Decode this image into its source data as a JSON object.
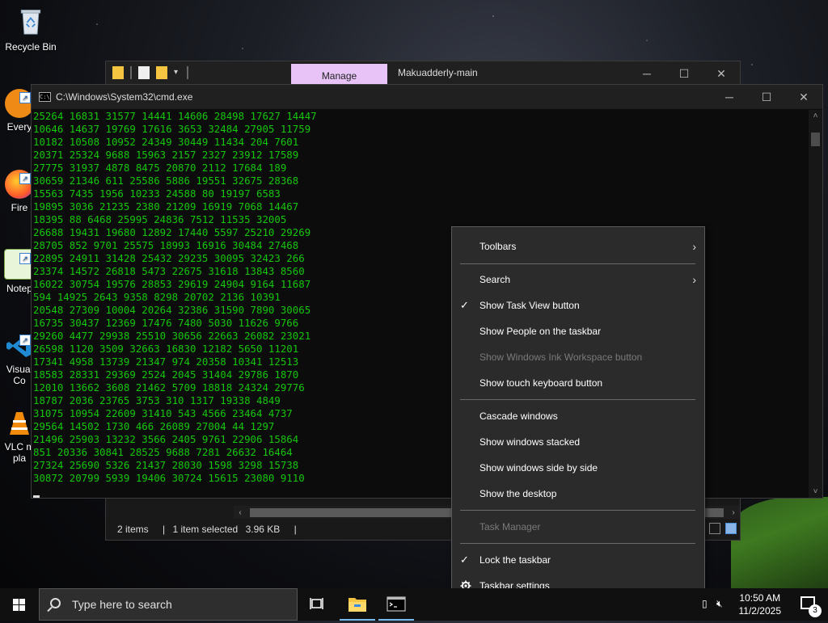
{
  "desktop": {
    "icons": [
      {
        "label": "Recycle Bin"
      },
      {
        "label": "Every"
      },
      {
        "label": "Fire"
      },
      {
        "label": "Notep"
      },
      {
        "label": "Visual"
      },
      {
        "label": "Co"
      },
      {
        "label": "VLC m"
      },
      {
        "label": "pla"
      }
    ]
  },
  "explorer": {
    "manage_tab": "Manage",
    "title": "Makuadderly-main",
    "status": {
      "items": "2 items",
      "selected": "1 item selected",
      "size": "3.96 KB"
    }
  },
  "cmd": {
    "title": "C:\\Windows\\System32\\cmd.exe",
    "lines": [
      "25264 16831 31577 14441 14606 28498 17627 14447",
      "10646 14637 19769 17616 3653 32484 27905 11759",
      "10182 10508 10952 24349 30449 11434 204 7601",
      "20371 25324 9688 15963 2157 2327 23912 17589",
      "27775 31937 4878 8475 20870 2112 17684 189",
      "30659 21346 611 25586 5886 19551 32675 28368",
      "15563 7435 1956 10233 24588 80 19197 6583",
      "19895 3036 21235 2380 21209 16919 7068 14467",
      "18395 88 6468 25995 24836 7512 11535 32005",
      "26688 19431 19680 12892 17440 5597 25210 29269",
      "28705 852 9701 25575 18993 16916 30484 27468",
      "22895 24911 31428 25432 29235 30095 32423 266",
      "23374 14572 26818 5473 22675 31618 13843 8560",
      "16022 30754 19576 28853 29619 24904 9164 11687",
      "594 14925 2643 9358 8298 20702 2136 10391",
      "20548 27309 10004 20264 32386 31590 7890 30065",
      "16735 30437 12369 17476 7480 5030 11626 9766",
      "29260 4477 29938 25510 30656 22663 26082 23021",
      "26598 1120 3509 32663 16830 12182 5650 11201",
      "17341 4958 13739 21347 974 20358 10341 12513",
      "18583 28331 29369 2524 2045 31404 29786 1870",
      "12010 13662 3608 21462 5709 18818 24324 29776",
      "18787 2036 23765 3753 310 1317 19338 4849",
      "31075 10954 22609 31410 543 4566 23464 4737",
      "29564 14502 1730 466 26089 27004 44 1297",
      "21496 25903 13232 3566 2405 9761 22906 15864",
      "851 20336 30841 28525 9688 7281 26632 16464",
      "27324 25690 5326 21437 28030 1598 3298 15738",
      "30872 20799 5939 19406 30724 15615 23080 9110"
    ]
  },
  "context_menu": {
    "toolbars": "Toolbars",
    "search": "Search",
    "task_view": "Show Task View button",
    "people": "Show People on the taskbar",
    "ink": "Show Windows Ink Workspace button",
    "touch_keyboard": "Show touch keyboard button",
    "cascade": "Cascade windows",
    "stacked": "Show windows stacked",
    "side_by_side": "Show windows side by side",
    "desktop": "Show the desktop",
    "task_manager": "Task Manager",
    "lock": "Lock the taskbar",
    "settings": "Taskbar settings"
  },
  "taskbar": {
    "search_placeholder": "Type here to search",
    "time": "10:50 AM",
    "date": "11/2/2025",
    "notification_count": "3"
  }
}
